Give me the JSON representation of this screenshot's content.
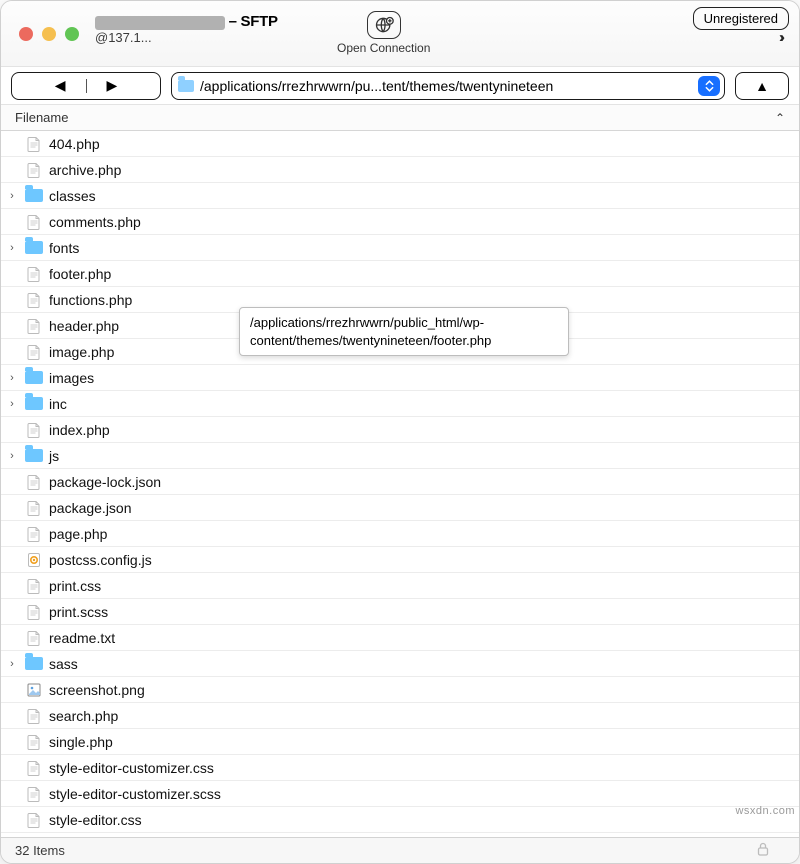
{
  "title_suffix": "– SFTP",
  "subtitle_prefix": "@137.1...",
  "open_connection_label": "Open Connection",
  "unregistered_label": "Unregistered",
  "path_display": "/applications/rrezhrwwrn/pu...tent/themes/twentynineteen",
  "column_header": "Filename",
  "tooltip": "/applications/rrezhrwwrn/public_html/wp-content/themes/twentynineteen/footer.php",
  "status_text": "32 Items",
  "watermark": "wsxdn.com",
  "files": [
    {
      "name": "404.php",
      "type": "file",
      "expandable": false
    },
    {
      "name": "archive.php",
      "type": "file",
      "expandable": false
    },
    {
      "name": "classes",
      "type": "folder",
      "expandable": true
    },
    {
      "name": "comments.php",
      "type": "file",
      "expandable": false
    },
    {
      "name": "fonts",
      "type": "folder",
      "expandable": true
    },
    {
      "name": "footer.php",
      "type": "file",
      "expandable": false
    },
    {
      "name": "functions.php",
      "type": "file",
      "expandable": false
    },
    {
      "name": "header.php",
      "type": "file",
      "expandable": false
    },
    {
      "name": "image.php",
      "type": "file",
      "expandable": false
    },
    {
      "name": "images",
      "type": "folder",
      "expandable": true
    },
    {
      "name": "inc",
      "type": "folder",
      "expandable": true
    },
    {
      "name": "index.php",
      "type": "file",
      "expandable": false
    },
    {
      "name": "js",
      "type": "folder",
      "expandable": true
    },
    {
      "name": "package-lock.json",
      "type": "file",
      "expandable": false
    },
    {
      "name": "package.json",
      "type": "file",
      "expandable": false
    },
    {
      "name": "page.php",
      "type": "file",
      "expandable": false
    },
    {
      "name": "postcss.config.js",
      "type": "jsconf",
      "expandable": false
    },
    {
      "name": "print.css",
      "type": "file",
      "expandable": false
    },
    {
      "name": "print.scss",
      "type": "file",
      "expandable": false
    },
    {
      "name": "readme.txt",
      "type": "file",
      "expandable": false
    },
    {
      "name": "sass",
      "type": "folder",
      "expandable": true
    },
    {
      "name": "screenshot.png",
      "type": "img",
      "expandable": false
    },
    {
      "name": "search.php",
      "type": "file",
      "expandable": false
    },
    {
      "name": "single.php",
      "type": "file",
      "expandable": false
    },
    {
      "name": "style-editor-customizer.css",
      "type": "file",
      "expandable": false
    },
    {
      "name": "style-editor-customizer.scss",
      "type": "file",
      "expandable": false
    },
    {
      "name": "style-editor.css",
      "type": "file",
      "expandable": false
    }
  ]
}
